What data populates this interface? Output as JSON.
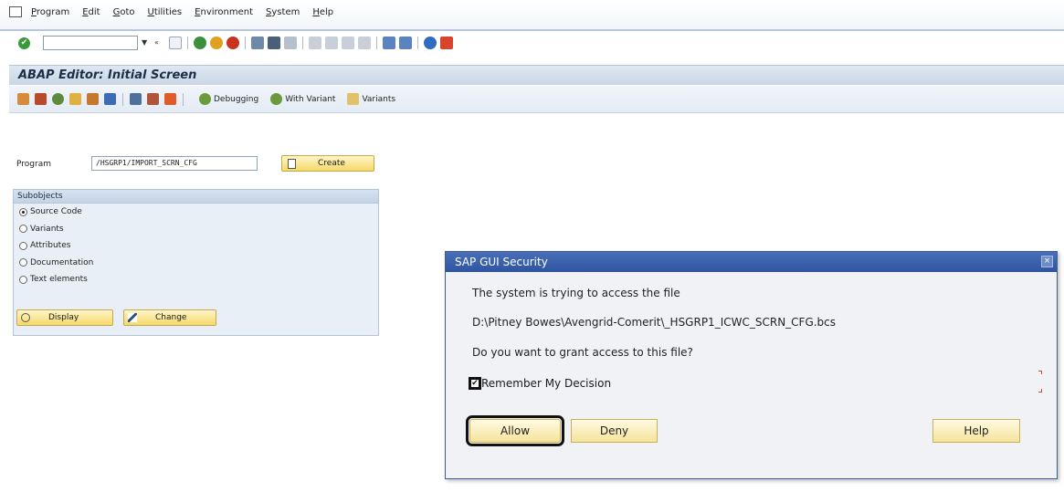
{
  "menubar": {
    "items": [
      "Program",
      "Edit",
      "Goto",
      "Utilities",
      "Environment",
      "System",
      "Help"
    ]
  },
  "screen": {
    "title": "ABAP Editor: Initial Screen"
  },
  "apptoolbar": {
    "debugging_label": "Debugging",
    "with_variant_label": "With Variant",
    "variants_label": "Variants"
  },
  "program": {
    "label": "Program",
    "value": "/HSGRP1/IMPORT_SCRN_CFG",
    "create_label": "Create"
  },
  "subobjects": {
    "header": "Subobjects",
    "options": [
      {
        "label": "Source Code",
        "checked": true
      },
      {
        "label": "Variants",
        "checked": false
      },
      {
        "label": "Attributes",
        "checked": false
      },
      {
        "label": "Documentation",
        "checked": false
      },
      {
        "label": "Text elements",
        "checked": false
      }
    ],
    "display_label": "Display",
    "change_label": "Change"
  },
  "dialog": {
    "title": "SAP GUI Security",
    "line1": "The system is trying to access the file",
    "file_path": "D:\\Pitney Bowes\\Avengrid-Comerit\\_HSGRP1_ICWC_SCRN_CFG.bcs",
    "question": "Do you want to grant access to this file?",
    "remember_label": "Remember My Decision",
    "remember_checked": true,
    "allow_label": "Allow",
    "deny_label": "Deny",
    "help_label": "Help",
    "close_glyph": "×"
  },
  "colors": {
    "dialog_title_bg": "#2e54a0",
    "button_yellow": "#f5d96a",
    "header_blue": "#c9d6e6"
  }
}
